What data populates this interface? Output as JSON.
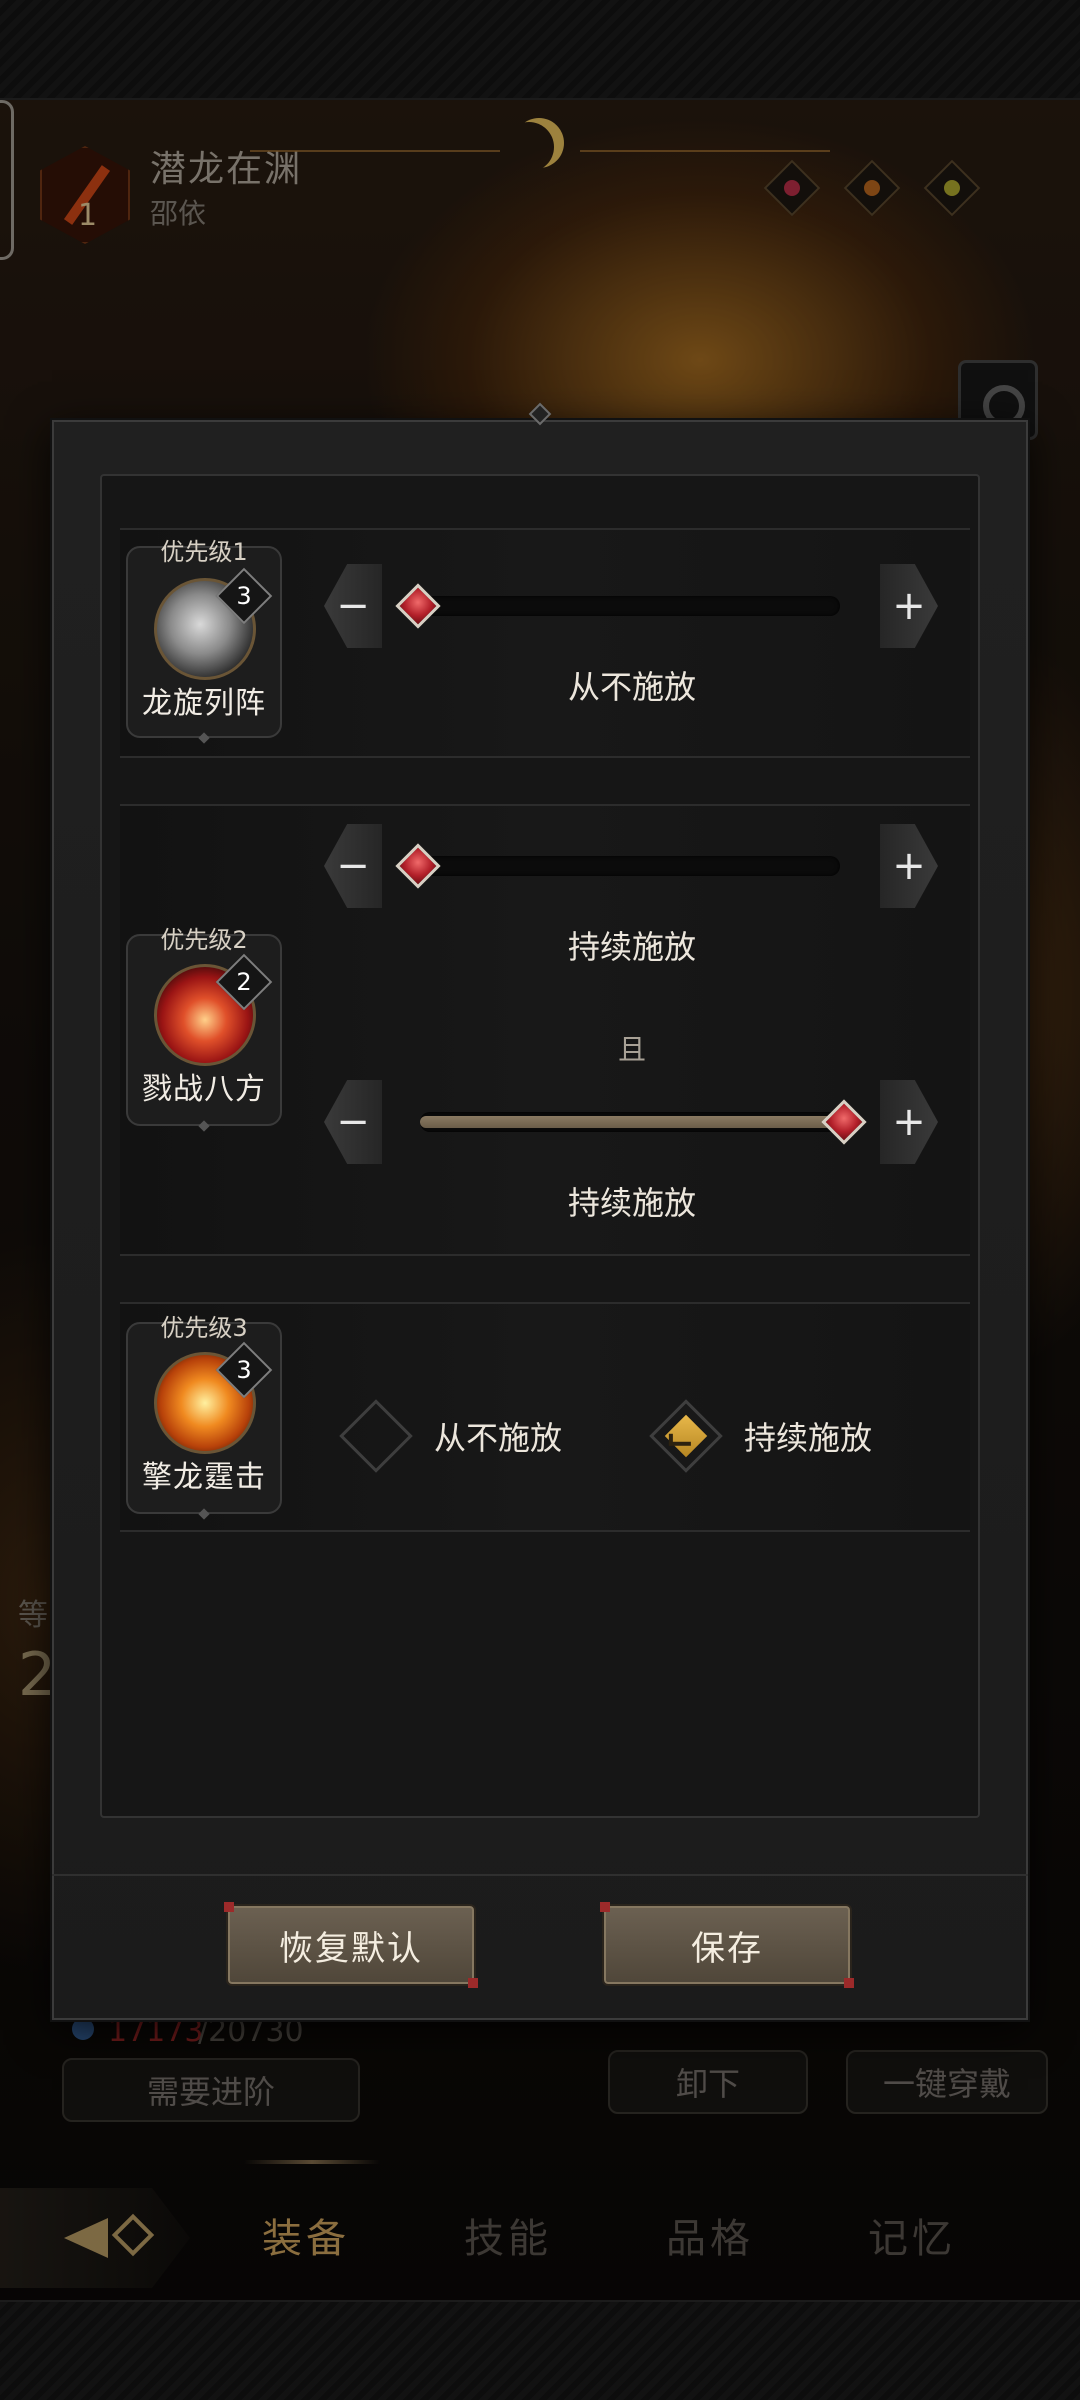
{
  "hero": {
    "name": "潜龙在渊",
    "subtitle": "邵依",
    "weapon_level": "1"
  },
  "background": {
    "mp_current": "17173",
    "mp_max": "/20730",
    "need_advance_label": "需要进阶",
    "unequip_label": "卸下",
    "one_click_equip_label": "一键穿戴",
    "level_number": "2",
    "level_prefix": "等"
  },
  "nav": {
    "tabs": [
      {
        "label": "装备",
        "active": true
      },
      {
        "label": "技能",
        "active": false
      },
      {
        "label": "品格",
        "active": false
      },
      {
        "label": "记忆",
        "active": false
      }
    ]
  },
  "dialog": {
    "skills": [
      {
        "priority": "优先级1",
        "name": "龙旋列阵",
        "level": "3",
        "icon": "dragon-whirl-skill-icon",
        "conditions": [
          {
            "value_label": "从不施放",
            "fill": 0.0
          }
        ]
      },
      {
        "priority": "优先级2",
        "name": "戮战八方",
        "level": "2",
        "icon": "eight-directions-slash-skill-icon",
        "conditions": [
          {
            "value_label": "持续施放",
            "fill": 0.0
          },
          {
            "value_label": "持续施放",
            "fill": 1.0
          }
        ],
        "conjunction": "且"
      },
      {
        "priority": "优先级3",
        "name": "擎龙霆击",
        "level": "3",
        "icon": "dragon-thunder-strike-skill-icon",
        "options": [
          {
            "label": "从不施放",
            "checked": false
          },
          {
            "label": "持续施放",
            "checked": true
          }
        ]
      }
    ],
    "minus_symbol": "−",
    "plus_symbol": "+",
    "reset_label": "恢复默认",
    "save_label": "保存"
  },
  "colors": {
    "accent_gold": "#d6aa62",
    "thumb_red": "#b3202a",
    "checked_gold": "#e8b84a"
  }
}
